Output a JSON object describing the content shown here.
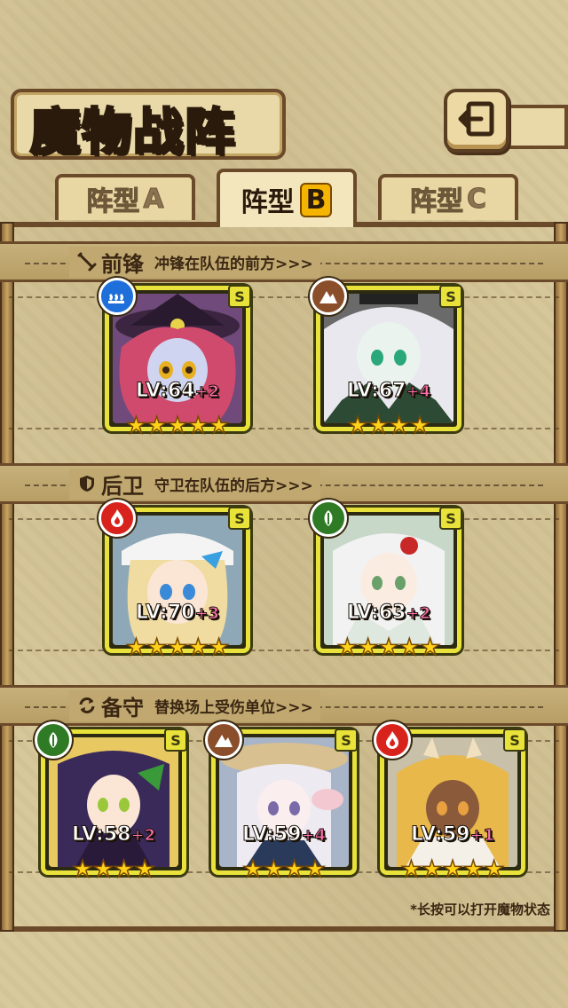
{
  "title": "魔物战阵",
  "back_icon": "back-arrow-icon",
  "tabs": [
    {
      "label": "阵型",
      "letter": "A",
      "active": false
    },
    {
      "label": "阵型",
      "letter": "B",
      "active": true
    },
    {
      "label": "阵型",
      "letter": "C",
      "active": false
    }
  ],
  "sections": {
    "front": {
      "title": "前锋",
      "desc": "冲锋在队伍的前方>>>",
      "icon": "sword-icon"
    },
    "rear": {
      "title": "后卫",
      "desc": "守卫在队伍的后方>>>",
      "icon": "shield-icon"
    },
    "reserve": {
      "title": "备守",
      "desc": "替换场上受伤单位>>>",
      "icon": "swap-icon"
    }
  },
  "cards": {
    "front": [
      {
        "lv": "LV:64",
        "plus": "+2",
        "stars": 5,
        "rank": "S",
        "element": "water",
        "element_color": "#1e6fd9"
      },
      {
        "lv": "LV:67",
        "plus": "+4",
        "stars": 4,
        "rank": "S",
        "element": "earth",
        "element_color": "#8a4e2a"
      }
    ],
    "rear": [
      {
        "lv": "LV:70",
        "plus": "+3",
        "stars": 5,
        "rank": "S",
        "element": "fire",
        "element_color": "#d8231d"
      },
      {
        "lv": "LV:63",
        "plus": "+2",
        "stars": 5,
        "rank": "S",
        "element": "wind",
        "element_color": "#2f7a25"
      }
    ],
    "reserve": [
      {
        "lv": "LV:58",
        "plus": "+2",
        "stars": 4,
        "rank": "S",
        "element": "wind",
        "element_color": "#2f7a25"
      },
      {
        "lv": "LV:59",
        "plus": "+4",
        "stars": 4,
        "rank": "S",
        "element": "earth",
        "element_color": "#8a4e2a"
      },
      {
        "lv": "LV:59",
        "plus": "+1",
        "stars": 5,
        "rank": "S",
        "element": "fire",
        "element_color": "#d8231d"
      }
    ]
  },
  "footer_note": "*长按可以打开魔物状态"
}
